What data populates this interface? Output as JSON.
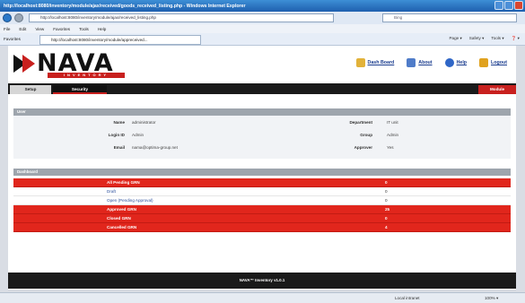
{
  "browser": {
    "title": "http://localhost:8080/inventory/module/ajax/received/goods_received_listing.php - Windows Internet Explorer",
    "address": "http://localhost:8080/inventory/module/ajax/received_listing.php",
    "search_placeholder": "Bing",
    "menu": [
      "File",
      "Edit",
      "View",
      "Favorites",
      "Tools",
      "Help"
    ],
    "favorites_label": "Favorites",
    "fav_tab": "http://localhost:8080/inventory/module/appreceived...",
    "tools": [
      "Page ▾",
      "Safety ▾",
      "Tools ▾",
      "❓ ▾"
    ],
    "status_zone": "Local intranet",
    "status_zoom": "100% ▾"
  },
  "app": {
    "logo_text": "NAVA",
    "logo_sub": "INVENTORY",
    "top_links": [
      {
        "label": "Dash Board",
        "icon": "dashboard-icon",
        "color": "#e2b23a"
      },
      {
        "label": "About",
        "icon": "about-icon",
        "color": "#4f7cc9"
      },
      {
        "label": "Help",
        "icon": "help-icon",
        "color": "#2f66c7"
      },
      {
        "label": "Logout",
        "icon": "logout-icon",
        "color": "#e0a21f"
      }
    ],
    "tabs": {
      "setup": "Setup",
      "security": "Security",
      "module": "Module"
    }
  },
  "user_section": {
    "title": "User",
    "name_label": "Name",
    "name_value": "administrator",
    "login_label": "Login ID",
    "login_value": "Admin",
    "email_label": "Email",
    "email_value": "nama@optima-group.net",
    "department_label": "Department",
    "department_value": "IT unit",
    "group_label": "Group",
    "group_value": "Admin",
    "approver_label": "Approver",
    "approver_value": "Yes"
  },
  "dashboard": {
    "title": "Dashboard",
    "rows": [
      {
        "name": "All Pending GRN",
        "count": "0",
        "style": "red"
      },
      {
        "name": "Draft",
        "count": "0",
        "style": "white"
      },
      {
        "name": "Open (Pending Approval)",
        "count": "0",
        "style": "white"
      },
      {
        "name": "Approved GRN",
        "count": "25",
        "style": "red"
      },
      {
        "name": "Closed GRN",
        "count": "0",
        "style": "red"
      },
      {
        "name": "Cancelled GRN",
        "count": "4",
        "style": "red"
      }
    ]
  },
  "footer": "NAVA™ Inventory v1.0.1",
  "colors": {
    "accent_red": "#e1261c",
    "dark": "#1a1a1a"
  }
}
